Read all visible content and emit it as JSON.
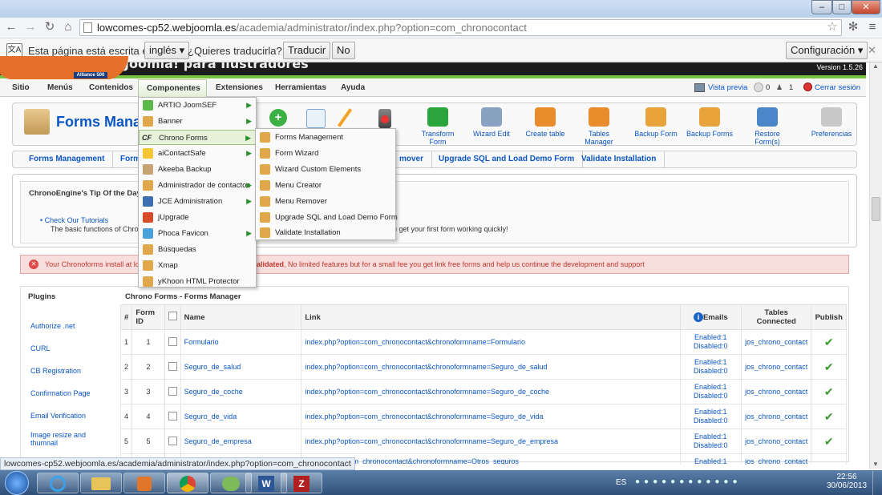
{
  "browser": {
    "url_host": "lowcomes-cp52.webjoomla.es",
    "url_path": "/academia/administrator/index.php?option=com_chronocontact",
    "translate": {
      "text1": "Esta página está escrita en",
      "lang": "inglés",
      "question": "¿Quieres traducirla?",
      "translate_btn": "Traducir",
      "no_btn": "No",
      "config_btn": "Configuración"
    },
    "status_url": "lowcomes-cp52.webjoomla.es/academia/administrator/index.php?option=com_chronocontact"
  },
  "header": {
    "logo_text": "Alliance 500",
    "site_title": "Joomla! para Ilustradores",
    "version": "Version 1.5.26"
  },
  "menu": {
    "items": [
      "Sitio",
      "Menús",
      "Contenidos",
      "Componentes",
      "Extensiones",
      "Herramientas",
      "Ayuda"
    ],
    "right": {
      "preview": "Vista previa",
      "count1": "0",
      "count2": "1",
      "logout": "Cerrar sesión"
    }
  },
  "toolbar": {
    "title": "Forms Manager",
    "buttons": [
      "Transform Form",
      "Wizard Edit",
      "Create table",
      "Tables Manager",
      "Backup Form",
      "Backup Forms",
      "Restore Form(s)",
      "Preferencias"
    ]
  },
  "subtabs": [
    "Forms Management",
    "Form",
    "mover",
    "Upgrade SQL and Load Demo Form",
    "Validate Installation"
  ],
  "dropdown": {
    "items": [
      "ARTIO JoomSEF",
      "Banner",
      "Chrono Forms",
      "aiContactSafe",
      "Akeeba Backup",
      "Administrador de contactos",
      "JCE Administration",
      "jUpgrade",
      "Phoca Favicon",
      "Búsquedas",
      "Xmap",
      "yKhoon HTML Protector"
    ],
    "chrono_prefix": "CF",
    "sub": [
      "Forms Management",
      "Form Wizard",
      "Wizard Custom Elements",
      "Menu Creator",
      "Menu Remover",
      "Upgrade SQL and Load Demo Form",
      "Validate Installation"
    ]
  },
  "tip": {
    "title": "ChronoEngine's Tip Of the Day",
    "link": "Check Our Tutorials",
    "text_left": "The basic functions of Chron",
    "text_right": "u get your first form working quickly!"
  },
  "alert": {
    "left": "Your Chronoforms install at lo",
    "bold": "alidated",
    "rest": ", No limited features but for a small fee you get link free forms and help us continue the development and support"
  },
  "plugins": {
    "title": "Plugins",
    "items": [
      "Authorize .net",
      "CURL",
      "CB Registration",
      "Confirmation Page",
      "Email Verification",
      "Image resize and thumnail"
    ]
  },
  "forms": {
    "title": "Chrono Forms - Forms Manager",
    "headers": [
      "#",
      "Form ID",
      "",
      "Name",
      "Link",
      "Emails",
      "Tables Connected",
      "Publish"
    ],
    "rows": [
      {
        "n": "1",
        "id": "1",
        "name": "Formulario",
        "link": "index.php?option=com_chronocontact&chronoformname=Formulario",
        "en": "Enabled:1",
        "dis": "Disabled:0",
        "table": "jos_chrono_contact"
      },
      {
        "n": "2",
        "id": "2",
        "name": "Seguro_de_salud",
        "link": "index.php?option=com_chronocontact&chronoformname=Seguro_de_salud",
        "en": "Enabled:1",
        "dis": "Disabled:0",
        "table": "jos_chrono_contact"
      },
      {
        "n": "3",
        "id": "3",
        "name": "Seguro_de_coche",
        "link": "index.php?option=com_chronocontact&chronoformname=Seguro_de_coche",
        "en": "Enabled:1",
        "dis": "Disabled:0",
        "table": "jos_chrono_contact"
      },
      {
        "n": "4",
        "id": "4",
        "name": "Seguro_de_vida",
        "link": "index.php?option=com_chronocontact&chronoformname=Seguro_de_vida",
        "en": "Enabled:1",
        "dis": "Disabled:0",
        "table": "jos_chrono_contact"
      },
      {
        "n": "5",
        "id": "5",
        "name": "Seguro_de_empresa",
        "link": "index.php?option=com_chronocontact&chronoformname=Seguro_de_empresa",
        "en": "Enabled:1",
        "dis": "Disabled:0",
        "table": "jos_chrono_contact"
      }
    ],
    "partial_row": {
      "link": "php?option=com_chronocontact&chronoformname=Otros_seguros",
      "en": "Enabled:1",
      "table": "jos_chrono_contact"
    }
  },
  "taskbar": {
    "lang": "ES",
    "time": "22:56",
    "date": "30/06/2013"
  },
  "colors": {
    "accent": "#0b55c4",
    "green": "#7bc142",
    "alert_bg": "#f9dede",
    "alert_text": "#c0392b"
  }
}
